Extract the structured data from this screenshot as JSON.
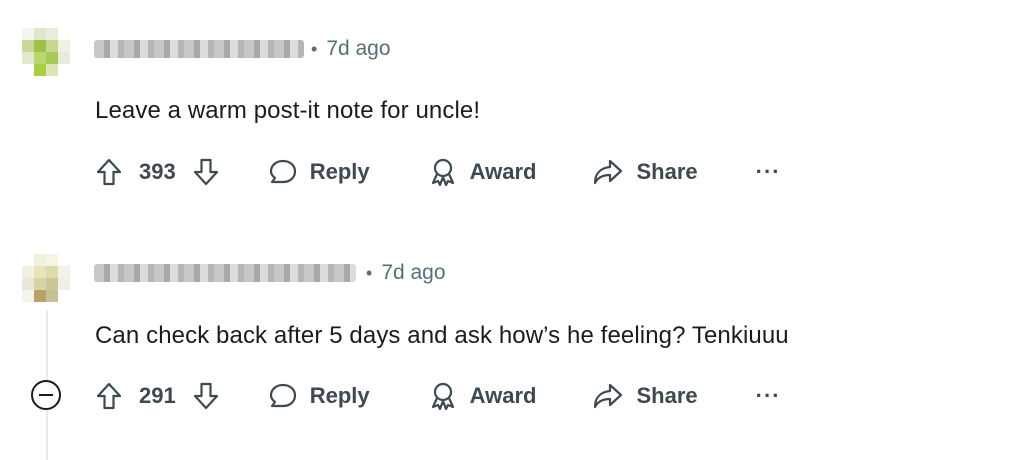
{
  "comments": [
    {
      "time": "7d ago",
      "text": "Leave a warm post-it note for uncle!",
      "score": "393",
      "reply_label": "Reply",
      "award_label": "Award",
      "share_label": "Share",
      "more_label": "···"
    },
    {
      "time": "7d ago",
      "text": "Can check back after 5 days and ask how’s he feeling? Tenkiuuu",
      "score": "291",
      "reply_label": "Reply",
      "award_label": "Award",
      "share_label": "Share",
      "more_label": "···"
    }
  ],
  "meta_separator": "•",
  "colors": {
    "text": "#1c1c1c",
    "meta": "#576f76",
    "action": "#3e4a50"
  }
}
